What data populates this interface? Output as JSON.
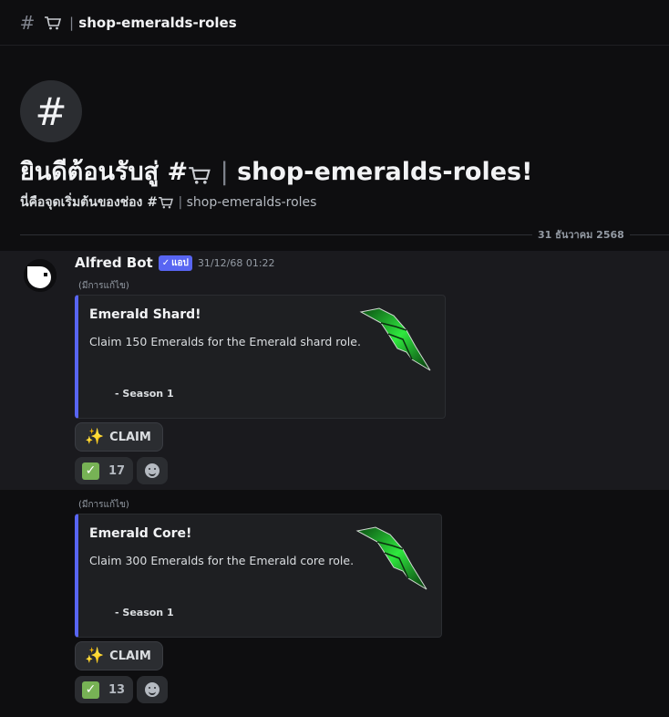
{
  "header": {
    "hash_icon": "channel-hash-icon",
    "channel_name": "shop-emeralds-roles",
    "channel_emoji": "cart-emoji",
    "separator": "|"
  },
  "welcome": {
    "title_prefix": "ยินดีต้อนรับสู่ #",
    "title_name": "shop-emeralds-roles!",
    "subtitle_prefix": "นี่คือจุดเริ่มต้นของช่อง #",
    "subtitle_name": "shop-emeralds-roles"
  },
  "date_divider": "31 ธันวาคม 2568",
  "message": {
    "author": "Alfred Bot",
    "badge": "แอป",
    "timestamp": "31/12/68 01:22"
  },
  "posts": [
    {
      "edited": "(มีการแก้ไข)",
      "embed_title": "Emerald Shard!",
      "embed_desc": "Claim 150 Emeralds for the Emerald shard role.",
      "embed_footer": "- Season 1",
      "button_label": "CLAIM",
      "reaction_count": "17"
    },
    {
      "edited": "(มีการแก้ไข)",
      "embed_title": "Emerald Core!",
      "embed_desc": "Claim 300 Emeralds for the Emerald core role.",
      "embed_footer": "- Season 1",
      "button_label": "CLAIM",
      "reaction_count": "13"
    }
  ],
  "colors": {
    "accent": "#5865f2",
    "emerald": "#1fbf2e",
    "check": "#77b255"
  }
}
